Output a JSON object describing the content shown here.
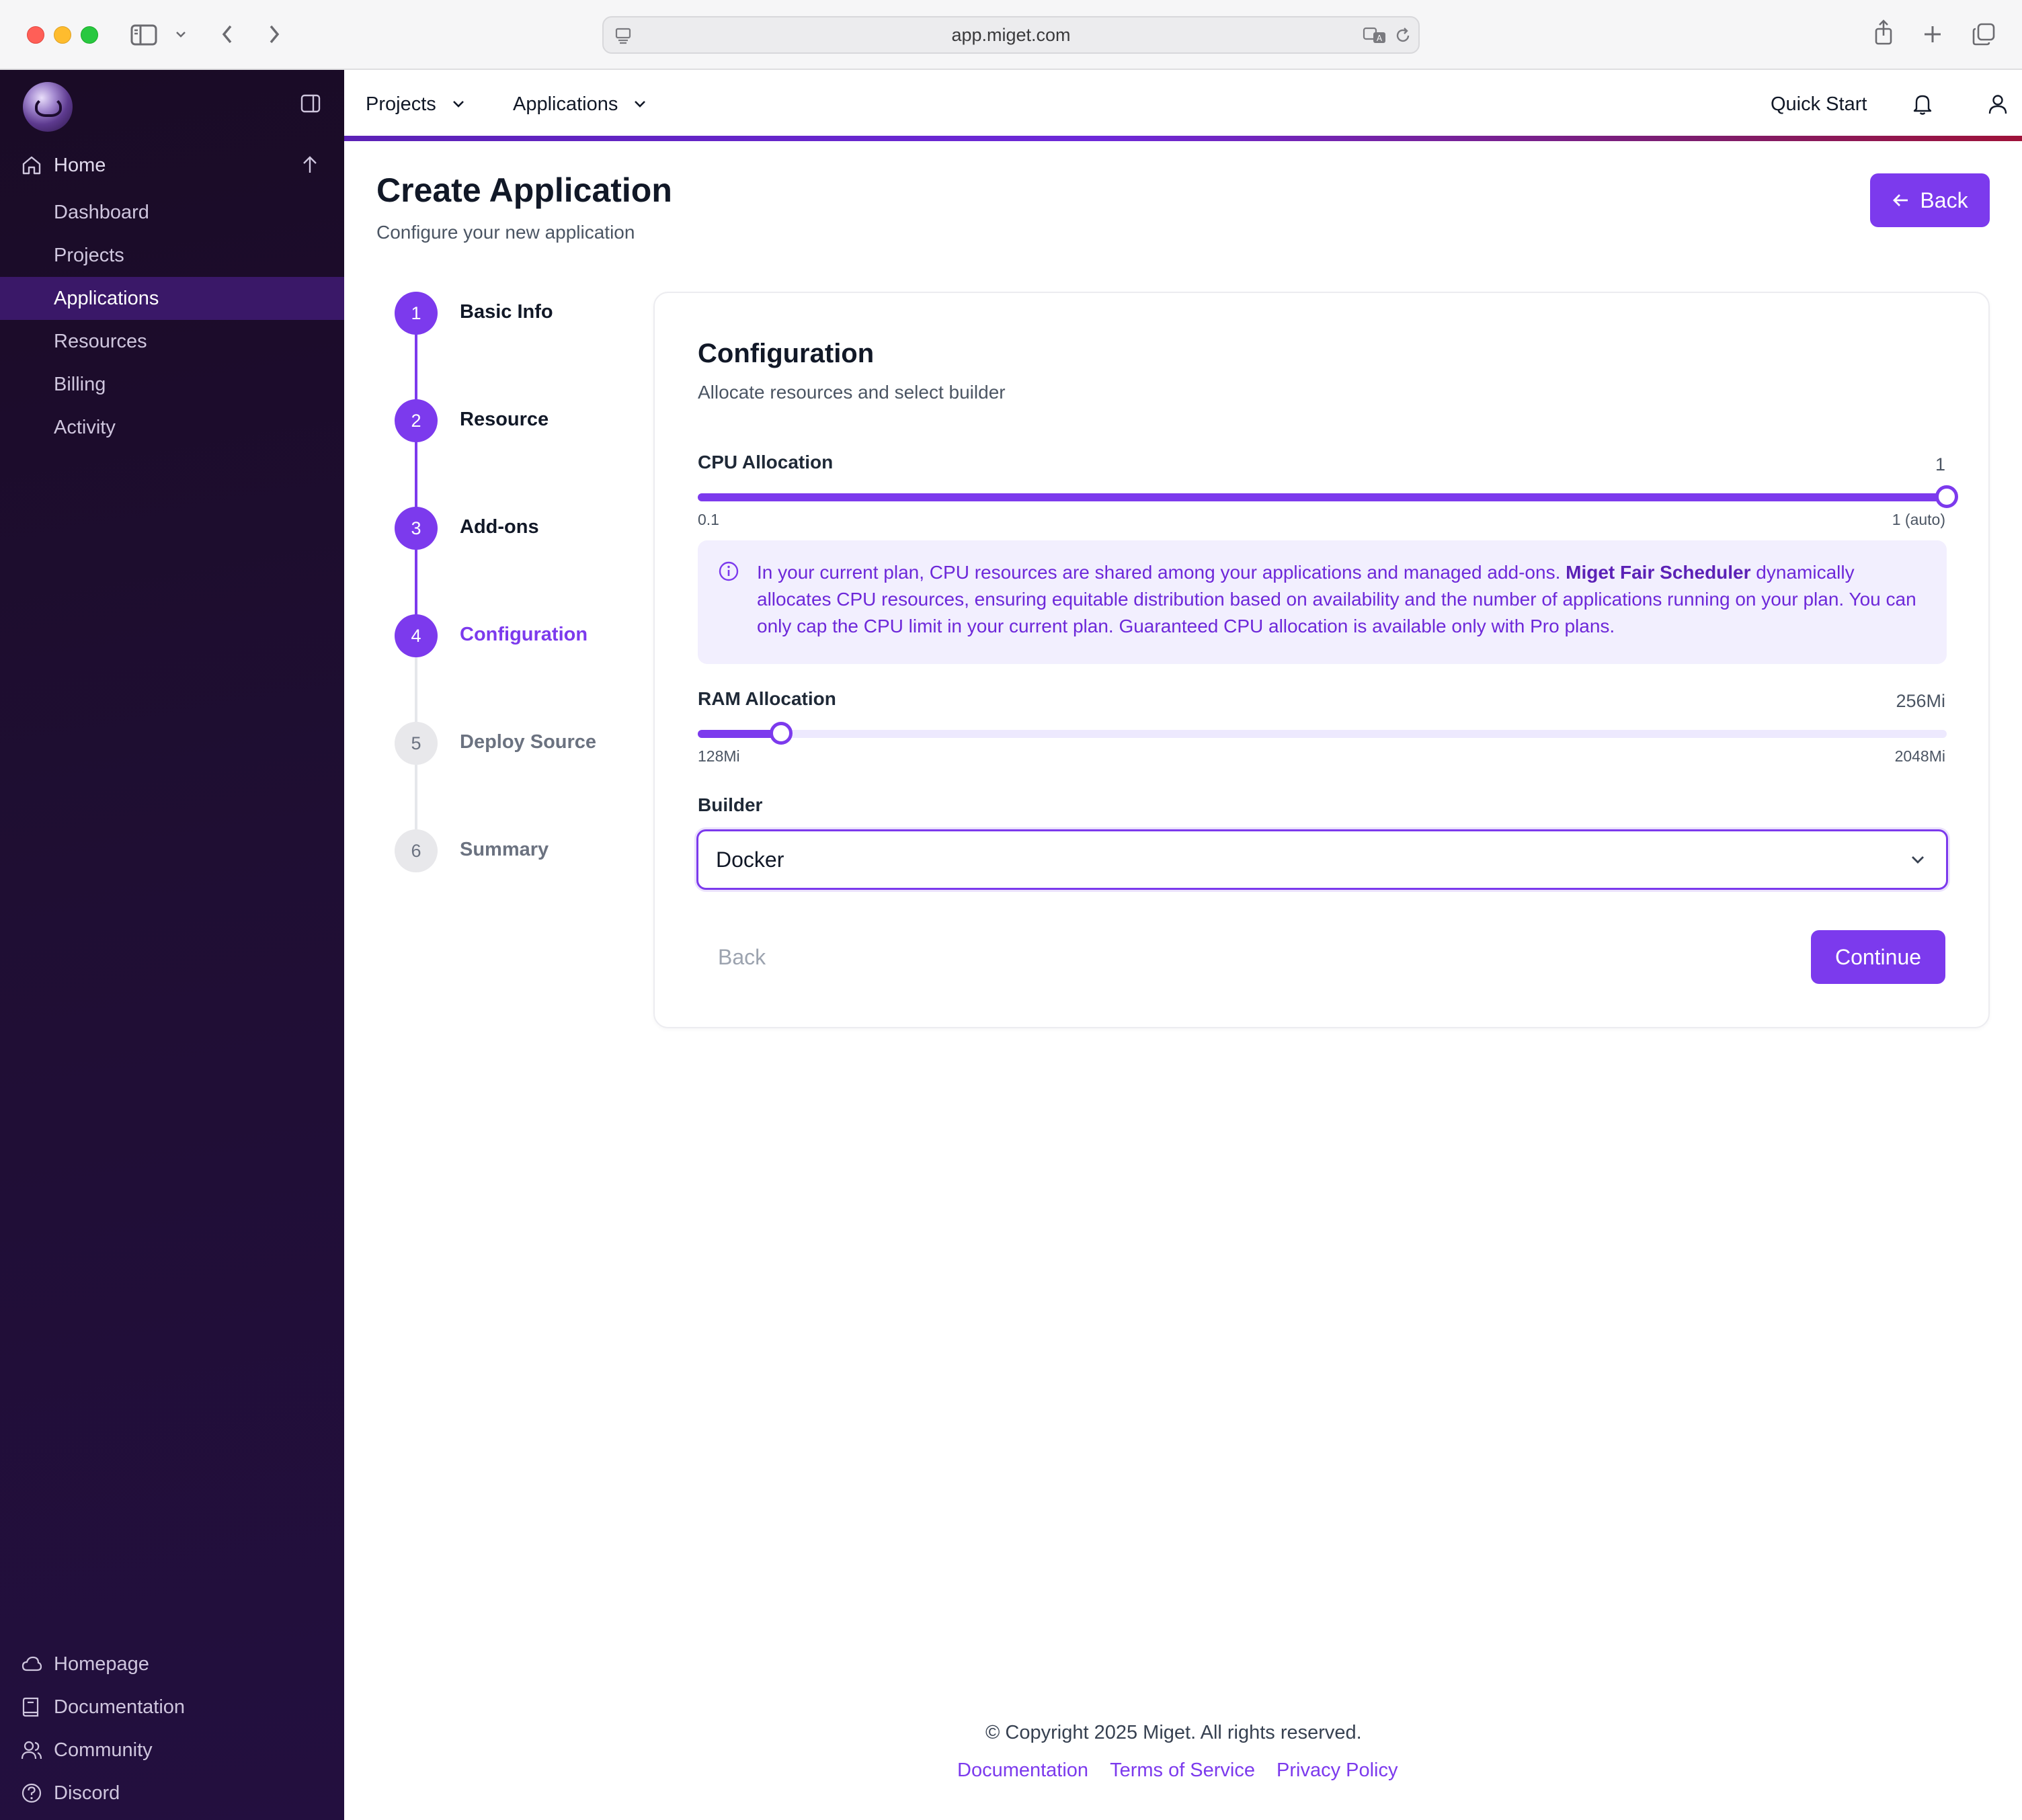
{
  "browser": {
    "url": "app.miget.com"
  },
  "sidebar": {
    "home_label": "Home",
    "items": [
      {
        "label": "Dashboard",
        "active": false
      },
      {
        "label": "Projects",
        "active": false
      },
      {
        "label": "Applications",
        "active": true
      },
      {
        "label": "Resources",
        "active": false
      },
      {
        "label": "Billing",
        "active": false
      },
      {
        "label": "Activity",
        "active": false
      }
    ],
    "footer_items": [
      {
        "label": "Homepage",
        "icon": "cloud-icon"
      },
      {
        "label": "Documentation",
        "icon": "book-icon"
      },
      {
        "label": "Community",
        "icon": "users-icon"
      },
      {
        "label": "Discord",
        "icon": "help-circle-icon"
      }
    ]
  },
  "topnav": {
    "projects_label": "Projects",
    "applications_label": "Applications",
    "quick_start_label": "Quick Start"
  },
  "page": {
    "title": "Create Application",
    "subtitle": "Configure your new application",
    "back_label": "Back"
  },
  "steps": [
    {
      "number": "1",
      "label": "Basic Info",
      "state": "done"
    },
    {
      "number": "2",
      "label": "Resource",
      "state": "done"
    },
    {
      "number": "3",
      "label": "Add-ons",
      "state": "done"
    },
    {
      "number": "4",
      "label": "Configuration",
      "state": "current"
    },
    {
      "number": "5",
      "label": "Deploy Source",
      "state": "todo"
    },
    {
      "number": "6",
      "label": "Summary",
      "state": "todo"
    }
  ],
  "config": {
    "title": "Configuration",
    "subtitle": "Allocate resources and select builder",
    "cpu": {
      "label": "CPU Allocation",
      "value": "1",
      "min_label": "0.1",
      "max_label": "1 (auto)",
      "fraction": 1.0
    },
    "info": {
      "text_before": "In your current plan, CPU resources are shared among your applications and managed add-ons. ",
      "highlight": "Miget Fair Scheduler",
      "text_after": " dynamically allocates CPU resources, ensuring equitable distribution based on availability and the number of applications running on your plan. You can only cap the CPU limit in your current plan. Guaranteed CPU allocation is available only with Pro plans."
    },
    "ram": {
      "label": "RAM Allocation",
      "value": "256Mi",
      "min_label": "128Mi",
      "max_label": "2048Mi",
      "fraction": 0.0667
    },
    "builder": {
      "label": "Builder",
      "selected": "Docker"
    },
    "back_label": "Back",
    "continue_label": "Continue"
  },
  "footer": {
    "copyright": "© Copyright 2025 Miget. All rights reserved.",
    "links": [
      "Documentation",
      "Terms of Service",
      "Privacy Policy"
    ]
  },
  "colors": {
    "accent": "#7c3aed",
    "sidebar_bg": "#1f0e33"
  }
}
